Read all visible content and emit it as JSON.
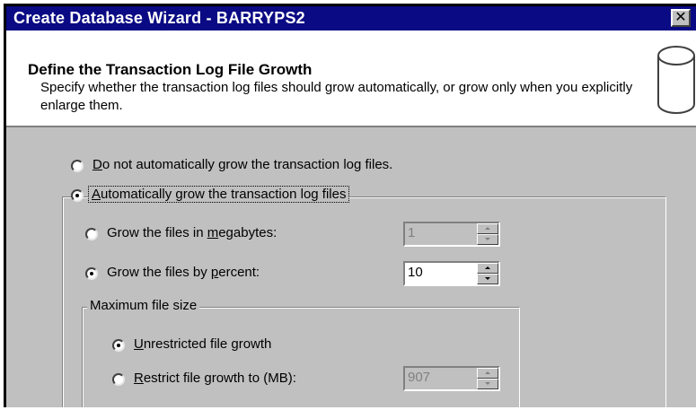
{
  "window": {
    "title": "Create Database Wizard - BARRYPS2",
    "close_glyph": "✕"
  },
  "header": {
    "title": "Define the Transaction Log File Growth",
    "description": "Specify whether the transaction log files should grow automatically, or grow only when you explicitly enlarge them.",
    "icon": "database-cylinder-icon"
  },
  "options": {
    "no_autogrow": {
      "pre": "",
      "accel": "D",
      "post": "o not automatically grow the transaction log files.",
      "checked": false
    },
    "autogrow": {
      "pre": "",
      "accel": "A",
      "post": "utomatically grow the transaction log files",
      "checked": true
    },
    "grow_mb": {
      "pre": "Grow the files in ",
      "accel": "m",
      "post": "egabytes:",
      "checked": false,
      "value": "1",
      "enabled": false
    },
    "grow_percent": {
      "pre": "Grow the files by ",
      "accel": "p",
      "post": "ercent:",
      "checked": true,
      "value": "10",
      "enabled": true
    }
  },
  "max_size": {
    "legend": "Maximum file size",
    "unrestricted": {
      "pre": "",
      "accel": "U",
      "post": "nrestricted file growth",
      "checked": true
    },
    "restrict": {
      "pre": "",
      "accel": "R",
      "post": "estrict file growth to (MB):",
      "checked": false,
      "value": "907",
      "enabled": false
    }
  }
}
